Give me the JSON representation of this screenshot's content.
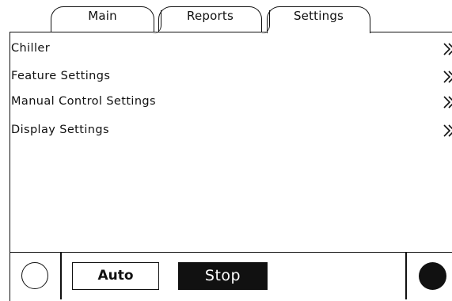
{
  "tabs": [
    {
      "label": "Main",
      "active": false
    },
    {
      "label": "Reports",
      "active": false
    },
    {
      "label": "Settings",
      "active": true
    }
  ],
  "menu": {
    "items": [
      {
        "label": "Chiller",
        "icon": "double-chevron-right-icon"
      },
      {
        "label": "Feature Settings",
        "icon": "double-chevron-right-icon"
      },
      {
        "label": "Manual Control Settings",
        "icon": "double-chevron-right-icon"
      },
      {
        "label": "Display Settings",
        "icon": "double-chevron-right-icon"
      }
    ]
  },
  "footer": {
    "auto_label": "Auto",
    "stop_label": "Stop",
    "left_indicator": "empty-circle-icon",
    "right_indicator": "filled-circle-icon"
  },
  "colors": {
    "ink": "#111111",
    "background": "#ffffff"
  }
}
